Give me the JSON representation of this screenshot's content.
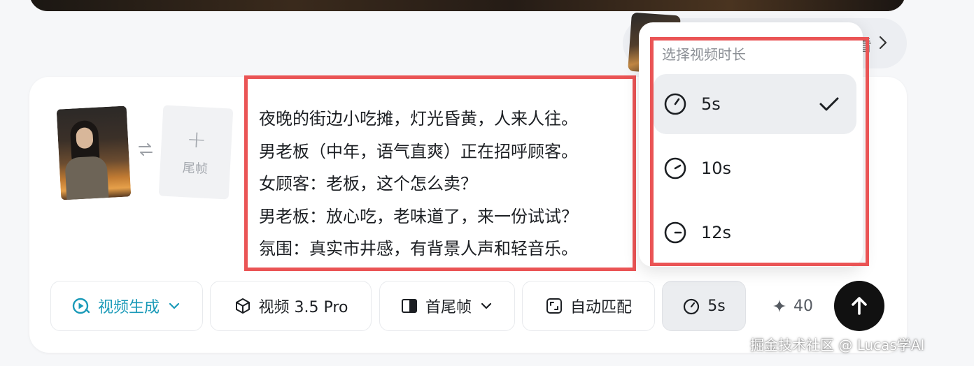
{
  "background_link": {
    "label": "看"
  },
  "first_frame": {
    "alt": ""
  },
  "last_frame": {
    "plus": "+",
    "label": "尾帧"
  },
  "prompt": {
    "lines": [
      "夜晚的街边小吃摊，灯光昏黄，人来人往。",
      "男老板（中年，语气直爽）正在招呼顾客。",
      "女顾客：老板，这个怎么卖？",
      "男老板：放心吃，老味道了，来一份试试？",
      "氛围：真实市井感，有背景人声和轻音乐。"
    ]
  },
  "toolbar": {
    "mode_label": "视频生成",
    "model_label": "视频 3.5 Pro",
    "frames_label": "首尾帧",
    "ratio_label": "自动匹配",
    "duration_label": "5s",
    "credits": "40"
  },
  "duration_menu": {
    "title": "选择视频时长",
    "options": [
      {
        "label": "5s",
        "selected": true
      },
      {
        "label": "10s",
        "selected": false
      },
      {
        "label": "12s",
        "selected": false
      }
    ]
  },
  "watermark": "掘金技术社区 @ Lucas学AI",
  "colors": {
    "accent": "#1a9ab8",
    "highlight_border": "#ea5455",
    "send_button": "#111111"
  }
}
